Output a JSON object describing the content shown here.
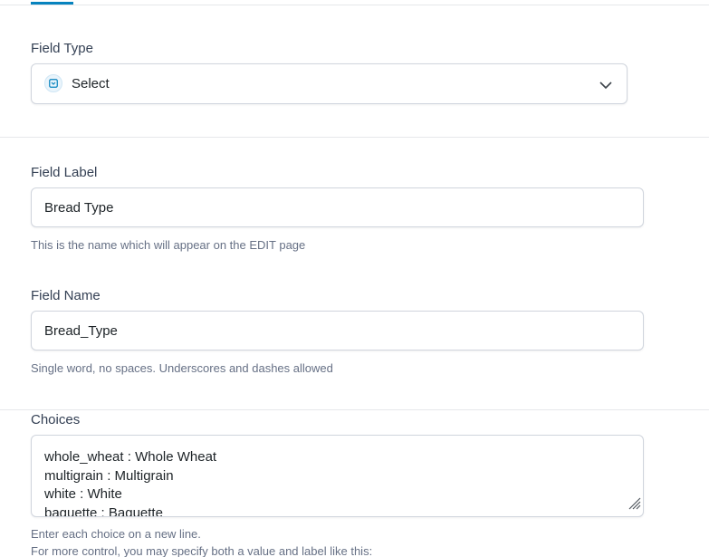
{
  "field_type": {
    "label": "Field Type",
    "selected": "Select",
    "icon": "select-type-icon"
  },
  "field_label": {
    "label": "Field Label",
    "value": "Bread Type",
    "hint": "This is the name which will appear on the EDIT page"
  },
  "field_name": {
    "label": "Field Name",
    "value": "Bread_Type",
    "hint": "Single word, no spaces. Underscores and dashes allowed"
  },
  "choices": {
    "label": "Choices",
    "lines": [
      "whole_wheat : Whole Wheat",
      "multigrain : Multigrain",
      "white : White",
      "baguette : Baguette"
    ],
    "hint_1": "Enter each choice on a new line.",
    "hint_2": "For more control, you may specify both a value and label like this:"
  },
  "colors": {
    "accent": "#0783be",
    "border": "#d0d5dd",
    "label_text": "#344054",
    "hint_text": "#667085"
  }
}
